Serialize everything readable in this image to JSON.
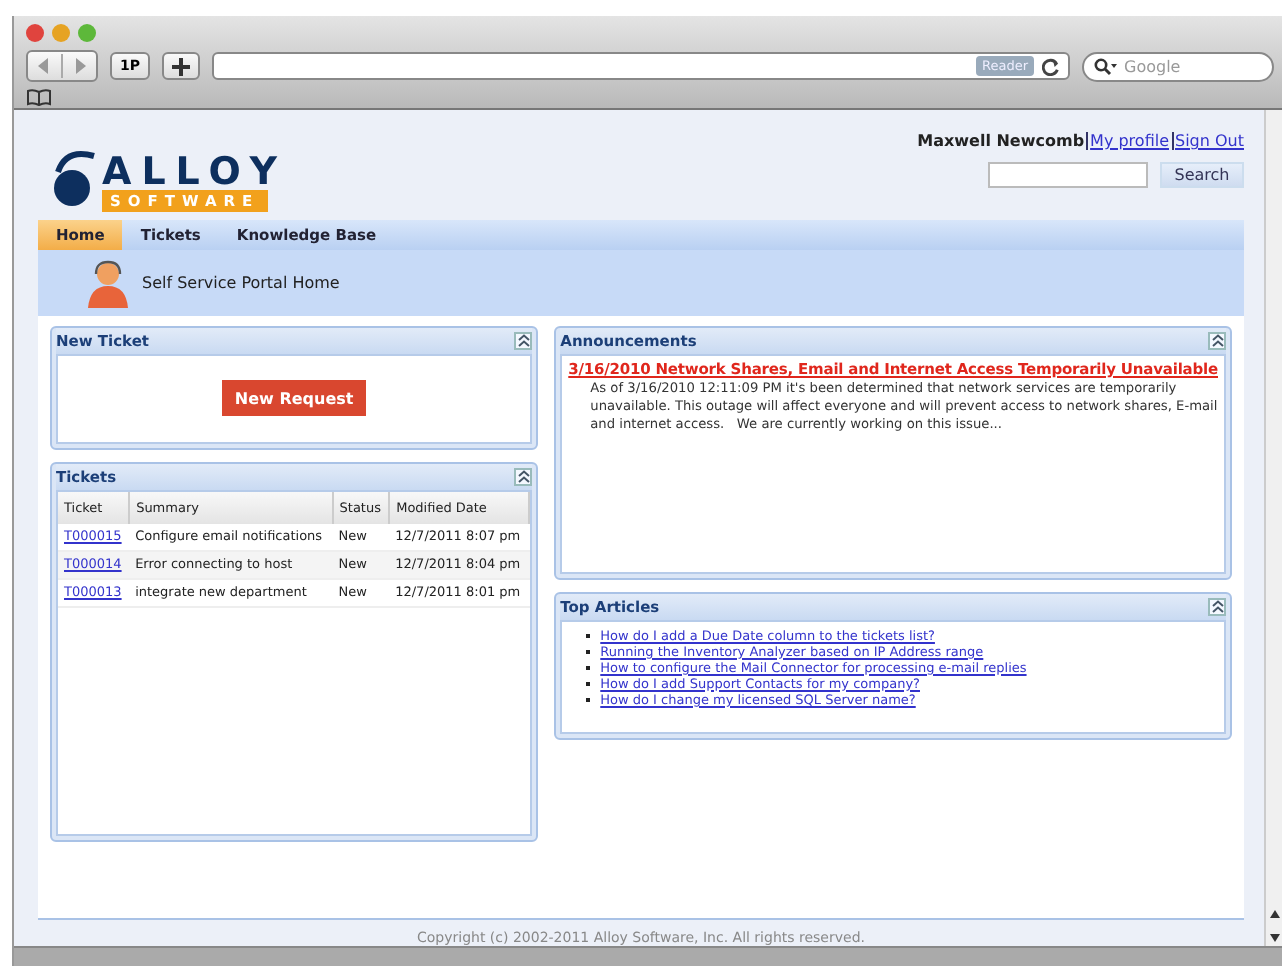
{
  "browser": {
    "toolbar_button": "1P",
    "reader": "Reader",
    "search_placeholder": "Google"
  },
  "logo": {
    "word": "ALLOY",
    "sub": "SOFTWARE"
  },
  "user": {
    "name": "Maxwell Newcomb",
    "links": [
      "My profile",
      "Sign Out"
    ]
  },
  "search": {
    "button": "Search"
  },
  "tabs": [
    {
      "label": "Home",
      "selected": true
    },
    {
      "label": "Tickets",
      "selected": false
    },
    {
      "label": "Knowledge Base",
      "selected": false
    }
  ],
  "banner": {
    "title": "Self Service Portal Home"
  },
  "new_ticket": {
    "title": "New Ticket",
    "button": "New Request"
  },
  "tickets": {
    "title": "Tickets",
    "columns": [
      "Ticket",
      "Summary",
      "Status",
      "Modified Date"
    ],
    "rows": [
      [
        "T000015",
        "Configure email notifications",
        "New",
        "12/7/2011 8:07 pm"
      ],
      [
        "T000014",
        "Error connecting to host",
        "New",
        "12/7/2011 8:04 pm"
      ],
      [
        "T000013",
        "integrate new department",
        "New",
        "12/7/2011 8:01 pm"
      ]
    ]
  },
  "announcements": {
    "title": "Announcements",
    "items": [
      {
        "headline": "3/16/2010 Network Shares, Email and Internet Access Temporarily Unavailable",
        "body": "As of 3/16/2010 12:11:09 PM it's been determined that network services are temporarily unavailable. This outage will affect everyone and will prevent access to network shares, E-mail and internet access.   We are currently working on this issue..."
      }
    ]
  },
  "top_articles": {
    "title": "Top Articles",
    "items": [
      "How do I add a Due Date column to the tickets list?",
      "Running the Inventory Analyzer based on IP Address range",
      "How to configure the Mail Connector for processing e-mail replies",
      "How do I add Support Contacts for my company?",
      "How do I change my licensed SQL Server name?"
    ]
  },
  "footer": "Copyright (c) 2002-2011 Alloy Software, Inc. All rights reserved."
}
